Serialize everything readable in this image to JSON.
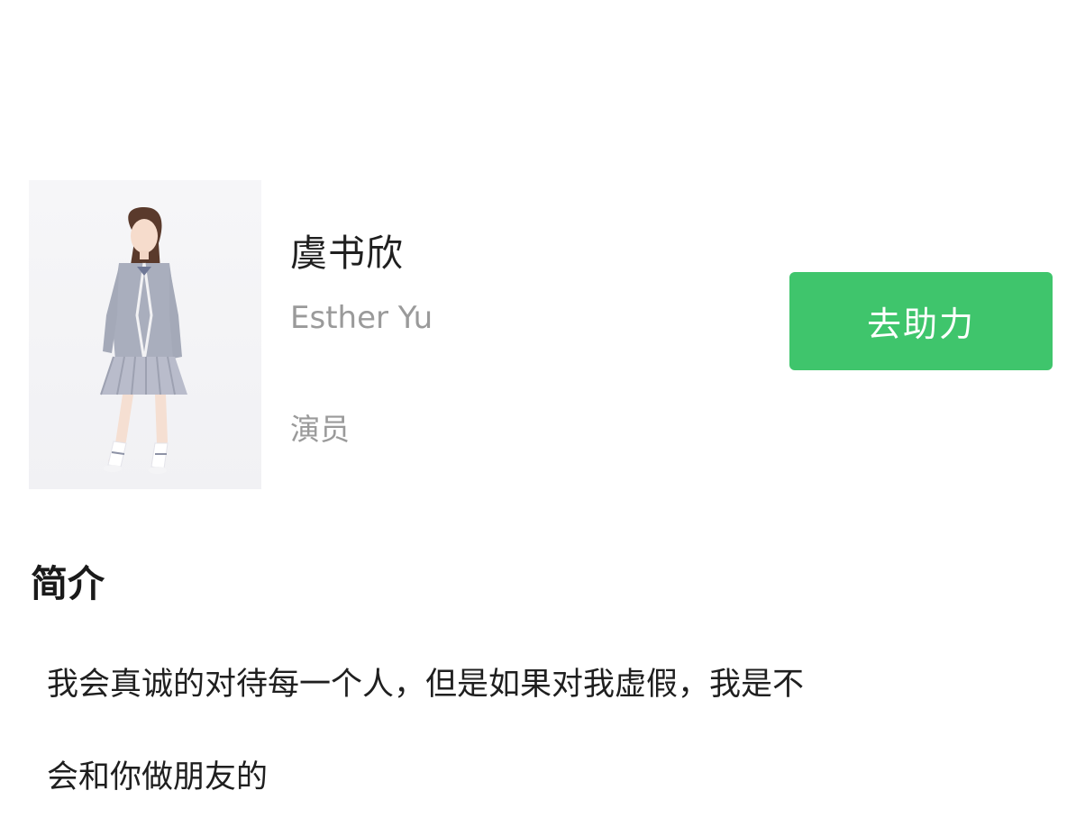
{
  "profile": {
    "photo_alt": "profile-photo",
    "name": "虞书欣",
    "english_name": "Esther Yu",
    "occupation": "演员"
  },
  "actions": {
    "support_label": "去助力",
    "accent_color": "#3fc56c"
  },
  "intro": {
    "title": "简介",
    "lines": [
      "我会真诚的对待每一个人，但是如果对我虚假，我是不",
      "会和你做朋友的"
    ]
  }
}
